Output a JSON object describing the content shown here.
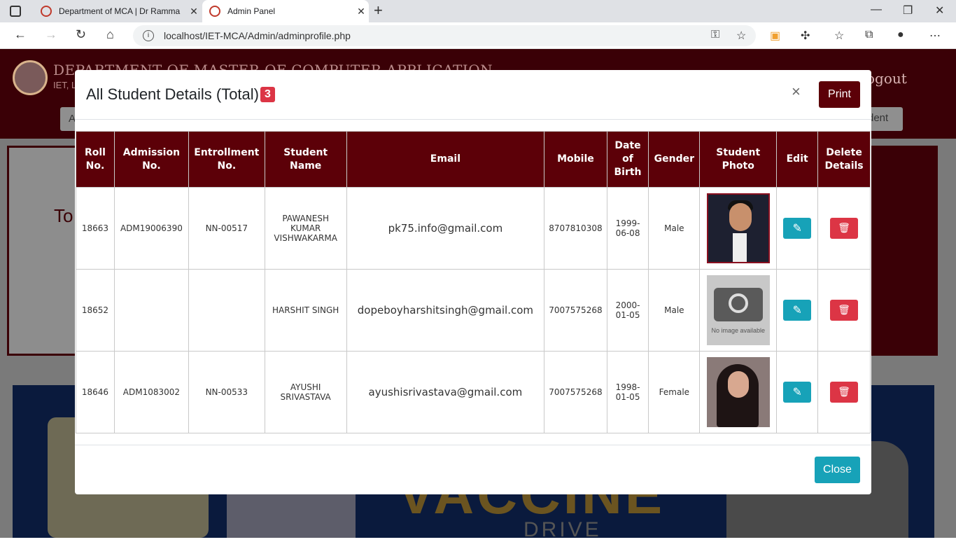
{
  "browser": {
    "tabs": [
      {
        "title": "Department of MCA | Dr Ramma"
      },
      {
        "title": "Admin Panel"
      }
    ],
    "url": "localhost/IET-MCA/Admin/adminprofile.php"
  },
  "background": {
    "header_title": "DEPARTMENT OF MASTER OF COMPUTER APPLICATION",
    "header_sub": "IET, L",
    "logout": "ogout",
    "nav_fragment_left": "A",
    "nav_fragment_right": "dent",
    "card_fragment": "To",
    "banner_text": "VACCINE",
    "banner_sub": "DRIVE"
  },
  "modal": {
    "title": "All Student Details (Total)",
    "count": "3",
    "print_label": "Print",
    "close_label": "Close",
    "close_x": "×",
    "columns": [
      "Roll No.",
      "Admission No.",
      "Entrollment No.",
      "Student Name",
      "Email",
      "Mobile",
      "Date of Birth",
      "Gender",
      "Student Photo",
      "Edit",
      "Delete Details"
    ],
    "rows": [
      {
        "roll": "18663",
        "admission": "ADM19006390",
        "enrollment": "NN-00517",
        "name": "PAWANESH KUMAR VISHWAKARMA",
        "email": "pk75.info@gmail.com",
        "mobile": "8707810308",
        "dob": "1999-06-08",
        "gender": "Male",
        "photo": "student-photo"
      },
      {
        "roll": "18652",
        "admission": "",
        "enrollment": "",
        "name": "HARSHIT SINGH",
        "email": "dopeboyharshitsingh@gmail.com",
        "mobile": "7007575268",
        "dob": "2000-01-05",
        "gender": "Male",
        "photo": "no-image",
        "no_image_text": "No image available"
      },
      {
        "roll": "18646",
        "admission": "ADM1083002",
        "enrollment": "NN-00533",
        "name": "AYUSHI SRIVASTAVA",
        "email": "ayushisrivastava@gmail.com",
        "mobile": "7007575268",
        "dob": "1998-01-05",
        "gender": "Female",
        "photo": "student-photo"
      }
    ]
  },
  "colors": {
    "maroon": "#5c0008",
    "info": "#17a2b8",
    "danger": "#dc3545"
  }
}
